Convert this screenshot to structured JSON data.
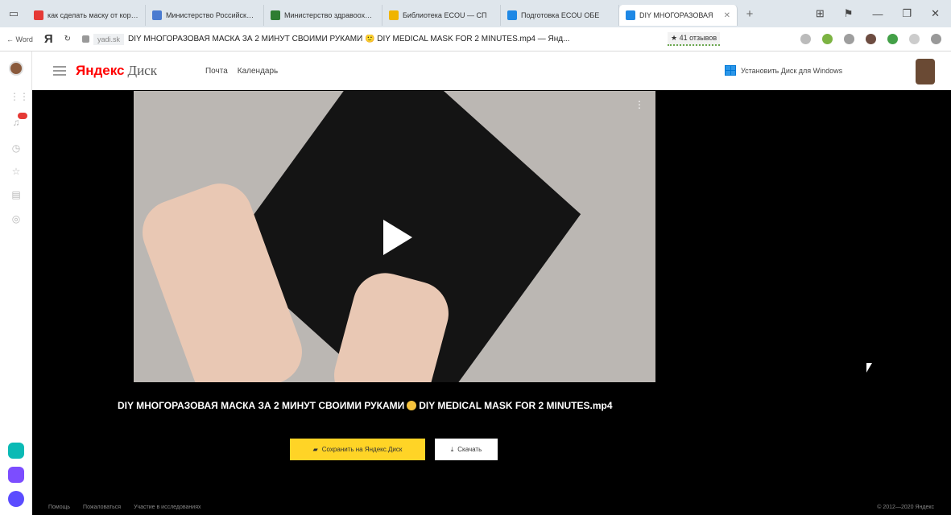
{
  "browser": {
    "tabs": [
      {
        "label": "как сделать маску от коронавируса",
        "color": "#e53935"
      },
      {
        "label": "Министерство Российской Федерации",
        "color": "#4a7bd0"
      },
      {
        "label": "Министерство здравоохранения",
        "color": "#2e7d32"
      },
      {
        "label": "Библиотека ECOU — СП",
        "color": "#f0b400"
      },
      {
        "label": "Подготовка ECOU ОБЕ",
        "color": "#1e88e5"
      },
      {
        "label": "DIY МНОГОРАЗОВАЯ",
        "color": "#1e88e5"
      }
    ],
    "new_tab": "+",
    "address": {
      "back_label": "Word",
      "yandex_glyph": "Я",
      "domain": "yadi.sk",
      "page_title": "DIY МНОГОРАЗОВАЯ МАСКА ЗА 2 МИНУТ СВОИМИ РУКАМИ 🙂 DIY MEDICAL MASK FOR 2 MINUTES.mp4 — Янд...",
      "reviews": "★ 41 отзывов"
    }
  },
  "header": {
    "logo_brand": "Яндекс",
    "logo_product": "Диск",
    "links": [
      "Почта",
      "Календарь"
    ],
    "install_label": "Установить Диск для Windows"
  },
  "main": {
    "filename": "DIY МНОГОРАЗОВАЯ МАСКА ЗА 2 МИНУТ СВОИМИ РУКАМИ",
    "filename_tail": "DIY MEDICAL MASK FOR 2 MINUTES.mp4",
    "save_button": "Сохранить на Яндекс.Диск",
    "download_button": "Скачать"
  },
  "footer": {
    "links": [
      "Помощь",
      "Пожаловаться",
      "Участие в исследованиях"
    ],
    "copyright": "© 2012—2020 Яндекс"
  }
}
